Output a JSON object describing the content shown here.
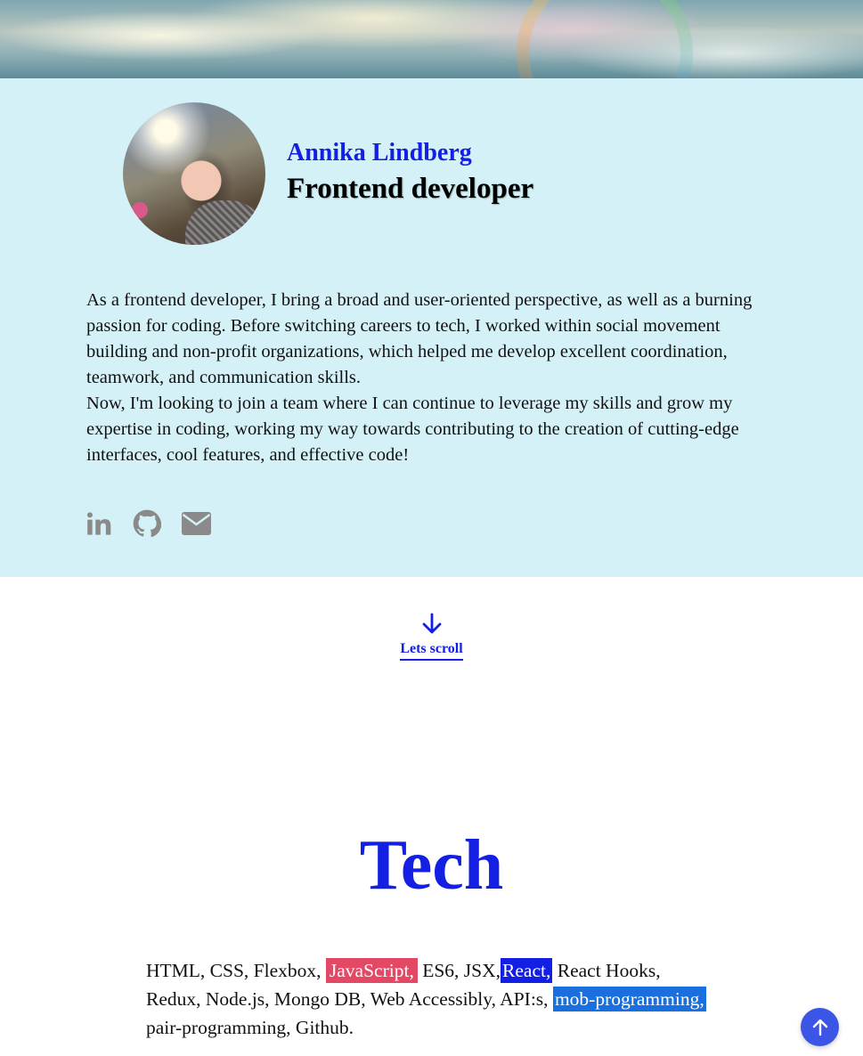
{
  "profile": {
    "name": "Annika Lindberg",
    "role": "Frontend developer"
  },
  "bio": {
    "paragraph_1": "As a frontend developer, I bring a broad and user-oriented perspective, as well as a burning passion for coding. Before switching careers to tech, I worked within social movement building and non-profit organizations, which helped me develop excellent coordination, teamwork, and communication skills.",
    "paragraph_2": "Now, I'm looking to join a team where I can continue to leverage my skills and grow my expertise in coding, working my way towards contributing to the creation of cutting-edge interfaces, cool features, and effective code!"
  },
  "social": {
    "icons": [
      "linkedin-icon",
      "github-icon",
      "envelope-icon"
    ],
    "icon_color": "#8a8a8a"
  },
  "scroll": {
    "label": "Lets scroll"
  },
  "tech": {
    "title": "Tech",
    "part_1": "HTML, CSS, Flexbox, ",
    "highlight_1": "JavaScript,",
    "part_2": " ES6, JSX,",
    "highlight_2": "React,",
    "part_3": " React Hooks, Redux, Node.js, Mongo DB, Web Accessibly, API:s, ",
    "highlight_3": "mob-programming,",
    "part_4": " pair-programming, Github."
  },
  "colors": {
    "accent": "#1320e3",
    "intro_background": "#d4f1f7",
    "highlight_red": "#e34865",
    "highlight_blue": "#1320e3",
    "highlight_mid_blue": "#1a6fdf",
    "back_to_top": "#3b55e6"
  }
}
